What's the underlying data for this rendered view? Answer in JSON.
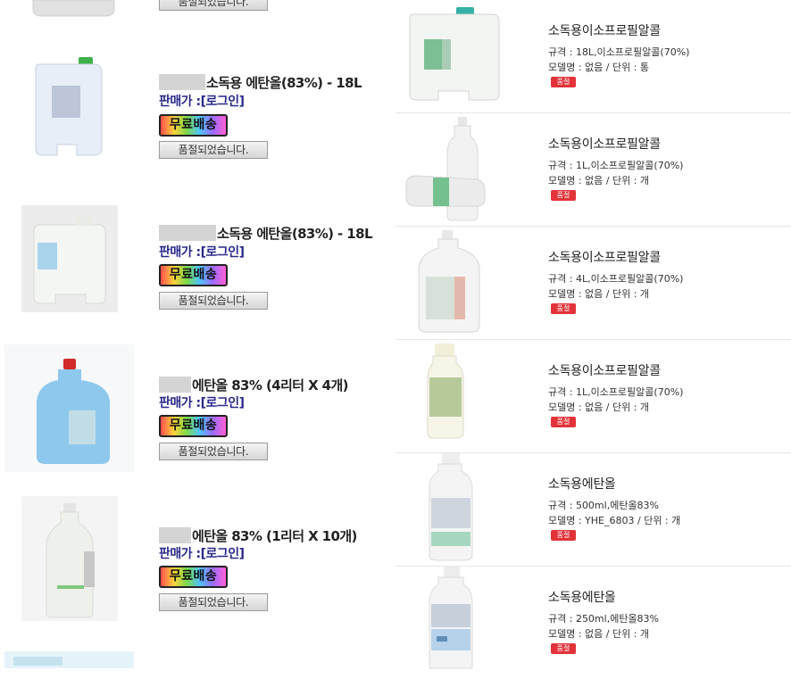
{
  "left_products": [
    {
      "title": "소독용 에탄올(83%) - 18L",
      "price_label": "판매가 :",
      "price_value": "[로그인]",
      "free_shipping": "무료배송",
      "status": "품절되었습니다."
    },
    {
      "title": "소독용 에탄올(83%) - 18L",
      "price_label": "판매가 :",
      "price_value": "[로그인]",
      "free_shipping": "무료배송",
      "status": "품절되었습니다."
    },
    {
      "title": "에탄올 83% (4리터 X 4개)",
      "price_label": "판매가 :",
      "price_value": "[로그인]",
      "free_shipping": "무료배송",
      "status": "품절되었습니다."
    },
    {
      "title": "에탄올 83% (1리터 X 10개)",
      "price_label": "판매가 :",
      "price_value": "[로그인]",
      "free_shipping": "무료배송",
      "status": "품절되었습니다."
    }
  ],
  "top_partial_status": "품절되었습니다.",
  "right_products": [
    {
      "name": "소독용이소프로필알콜",
      "spec": "규격 : 18L,이소프로필알콜(70%)",
      "model": "모델명 : 없음 / 단위 : 통",
      "badge": "품절"
    },
    {
      "name": "소독용이소프로필알콜",
      "spec": "규격 : 1L,이소프로필알콜(70%)",
      "model": "모델명 : 없음 / 단위 : 개",
      "badge": "품절"
    },
    {
      "name": "소독용이소프로필알콜",
      "spec": "규격 : 4L,이소프로필알콜(70%)",
      "model": "모델명 : 없음 / 단위 : 개",
      "badge": "품절"
    },
    {
      "name": "소독용이소프로필알콜",
      "spec": "규격 : 1L,이소프로필알콜(70%)",
      "model": "모델명 : 없음 / 단위 : 개",
      "badge": "품절"
    },
    {
      "name": "소독용에탄올",
      "spec": "규격 : 500ml,에탄올83%",
      "model": "모델명 : YHE_6803 / 단위 : 개",
      "badge": "품절"
    },
    {
      "name": "소독용에탄올",
      "spec": "규격 : 250ml,에탄올83%",
      "model": "모델명 : 없음 / 단위 : 개",
      "badge": "품절"
    }
  ]
}
